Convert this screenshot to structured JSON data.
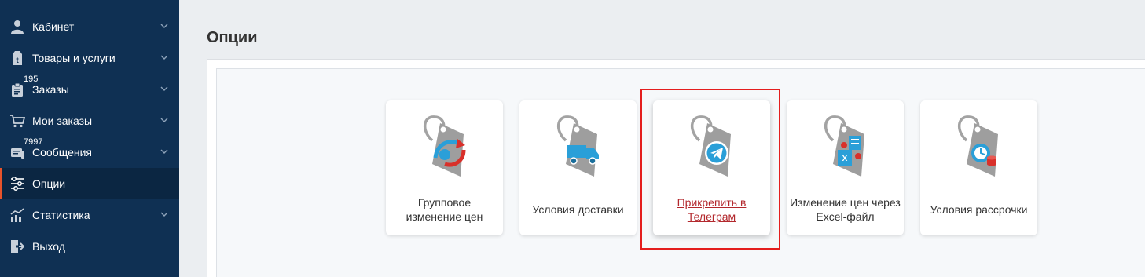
{
  "sidebar": {
    "items": [
      {
        "label": "Кабинет",
        "icon": "user-icon",
        "badge": "",
        "expandable": true,
        "active": false
      },
      {
        "label": "Товары и услуги",
        "icon": "products-tag-icon",
        "badge": "",
        "expandable": true,
        "active": false
      },
      {
        "label": "Заказы",
        "icon": "orders-clipboard-icon",
        "badge": "195",
        "expandable": true,
        "active": false
      },
      {
        "label": "Мои заказы",
        "icon": "cart-icon",
        "badge": "",
        "expandable": true,
        "active": false
      },
      {
        "label": "Сообщения",
        "icon": "messages-icon",
        "badge": "7997",
        "expandable": true,
        "active": false
      },
      {
        "label": "Опции",
        "icon": "options-sliders-icon",
        "badge": "",
        "expandable": false,
        "active": true
      },
      {
        "label": "Статистика",
        "icon": "statistics-chart-icon",
        "badge": "",
        "expandable": true,
        "active": false
      },
      {
        "label": "Выход",
        "icon": "logout-icon",
        "badge": "",
        "expandable": false,
        "active": false
      }
    ]
  },
  "main": {
    "title": "Опции",
    "cards": [
      {
        "label": "Групповое изменение цен",
        "icon": "group-price-change-icon",
        "selected": false
      },
      {
        "label": "Условия доставки",
        "icon": "delivery-truck-icon",
        "selected": false
      },
      {
        "label": "Прикрепить в Телеграм",
        "icon": "telegram-icon",
        "selected": true
      },
      {
        "label": "Изменение цен через Excel-файл",
        "icon": "excel-price-icon",
        "selected": false
      },
      {
        "label": "Условия рассрочки",
        "icon": "installment-icon",
        "selected": false
      }
    ]
  },
  "colors": {
    "sidebar_bg": "#0f3053",
    "sidebar_active_bg": "#0b2642",
    "accent": "#e8532b",
    "link": "#b3282d",
    "highlight": "#e41e1e",
    "tag_grey": "#9e9e9e",
    "icon_blue": "#2a9fd8",
    "icon_red": "#d9302a"
  }
}
